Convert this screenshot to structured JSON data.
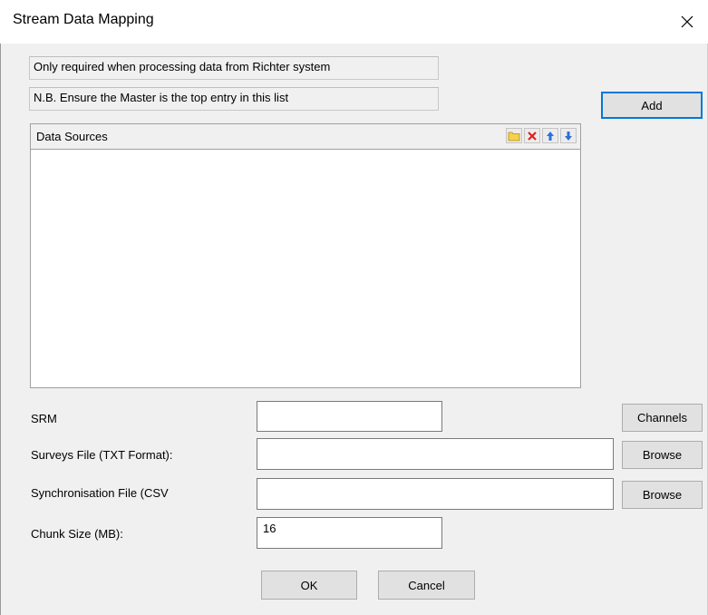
{
  "window": {
    "title": "Stream Data Mapping",
    "close_glyph": "✕"
  },
  "info": {
    "line1": "Only required when processing data from Richter system",
    "line2": "N.B. Ensure the Master is the top entry in this list"
  },
  "buttons": {
    "add": "Add",
    "channels": "Channels",
    "browse_surveys": "Browse",
    "browse_sync": "Browse",
    "ok": "OK",
    "cancel": "Cancel"
  },
  "data_sources": {
    "title": "Data Sources",
    "items": [],
    "toolbar_icons": [
      "folder-icon",
      "delete-icon",
      "move-up-icon",
      "move-down-icon"
    ]
  },
  "fields": {
    "srm": {
      "label": "SRM",
      "value": ""
    },
    "surveys_file": {
      "label": "Surveys File (TXT Format):",
      "value": ""
    },
    "sync_file": {
      "label": "Synchronisation File (CSV",
      "value": ""
    },
    "chunk_size": {
      "label": "Chunk Size (MB):",
      "value": "16"
    }
  },
  "colors": {
    "focus_border": "#0078d7",
    "dialog_bg": "#f0f0f0"
  }
}
